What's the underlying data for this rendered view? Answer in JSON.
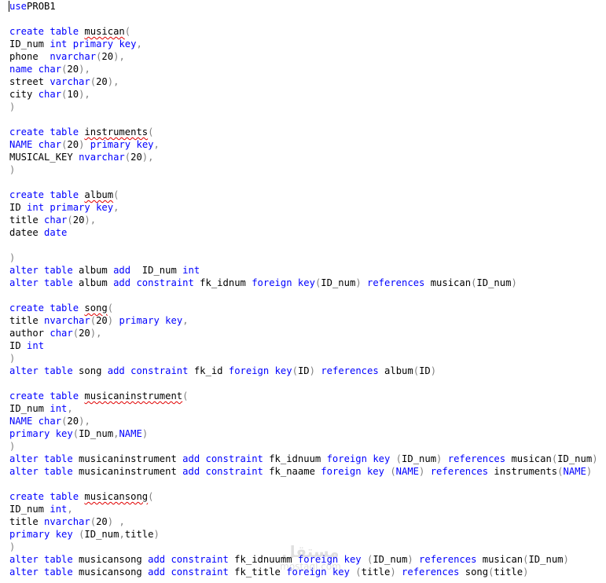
{
  "editor": {
    "lines": [
      [
        [
          "kw",
          "use"
        ],
        [
          "",
          "PROB1"
        ]
      ],
      [],
      [
        [
          "kw",
          "create"
        ],
        [
          "",
          " "
        ],
        [
          "kw",
          "table"
        ],
        [
          "",
          " "
        ],
        [
          "sq",
          "musican"
        ],
        [
          "gr",
          "("
        ]
      ],
      [
        [
          "",
          "ID_num "
        ],
        [
          "kw",
          "int"
        ],
        [
          "",
          " "
        ],
        [
          "kw",
          "primary"
        ],
        [
          "",
          " "
        ],
        [
          "kw",
          "key"
        ],
        [
          "gr",
          ","
        ]
      ],
      [
        [
          "",
          "phone  "
        ],
        [
          "kw",
          "nvarchar"
        ],
        [
          "gr",
          "("
        ],
        [
          "",
          "20"
        ],
        [
          "gr",
          ")"
        ],
        [
          "gr",
          ","
        ]
      ],
      [
        [
          "kw",
          "name"
        ],
        [
          "",
          " "
        ],
        [
          "kw",
          "char"
        ],
        [
          "gr",
          "("
        ],
        [
          "",
          "20"
        ],
        [
          "gr",
          ")"
        ],
        [
          "gr",
          ","
        ]
      ],
      [
        [
          "",
          "street "
        ],
        [
          "kw",
          "varchar"
        ],
        [
          "gr",
          "("
        ],
        [
          "",
          "20"
        ],
        [
          "gr",
          ")"
        ],
        [
          "gr",
          ","
        ]
      ],
      [
        [
          "",
          "city "
        ],
        [
          "kw",
          "char"
        ],
        [
          "gr",
          "("
        ],
        [
          "",
          "10"
        ],
        [
          "gr",
          ")"
        ],
        [
          "gr",
          ","
        ]
      ],
      [
        [
          "gr",
          ")"
        ]
      ],
      [],
      [
        [
          "kw",
          "create"
        ],
        [
          "",
          " "
        ],
        [
          "kw",
          "table"
        ],
        [
          "",
          " "
        ],
        [
          "sq",
          "instruments"
        ],
        [
          "gr",
          "("
        ]
      ],
      [
        [
          "kw",
          "NAME"
        ],
        [
          "",
          " "
        ],
        [
          "kw",
          "char"
        ],
        [
          "gr",
          "("
        ],
        [
          "",
          "20"
        ],
        [
          "gr",
          ")"
        ],
        [
          "",
          " "
        ],
        [
          "kw",
          "primary"
        ],
        [
          "",
          " "
        ],
        [
          "kw",
          "key"
        ],
        [
          "gr",
          ","
        ]
      ],
      [
        [
          "",
          "MUSICAL_KEY "
        ],
        [
          "kw",
          "nvarchar"
        ],
        [
          "gr",
          "("
        ],
        [
          "",
          "20"
        ],
        [
          "gr",
          ")"
        ],
        [
          "gr",
          ","
        ]
      ],
      [
        [
          "gr",
          ")"
        ]
      ],
      [],
      [
        [
          "kw",
          "create"
        ],
        [
          "",
          " "
        ],
        [
          "kw",
          "table"
        ],
        [
          "",
          " "
        ],
        [
          "sq",
          "album"
        ],
        [
          "gr",
          "("
        ]
      ],
      [
        [
          "",
          "ID "
        ],
        [
          "kw",
          "int"
        ],
        [
          "",
          " "
        ],
        [
          "kw",
          "primary"
        ],
        [
          "",
          " "
        ],
        [
          "kw",
          "key"
        ],
        [
          "gr",
          ","
        ]
      ],
      [
        [
          "",
          "title "
        ],
        [
          "kw",
          "char"
        ],
        [
          "gr",
          "("
        ],
        [
          "",
          "20"
        ],
        [
          "gr",
          ")"
        ],
        [
          "gr",
          ","
        ]
      ],
      [
        [
          "",
          "datee "
        ],
        [
          "kw",
          "date"
        ]
      ],
      [],
      [
        [
          "gr",
          ")"
        ]
      ],
      [
        [
          "kw",
          "alter"
        ],
        [
          "",
          " "
        ],
        [
          "kw",
          "table"
        ],
        [
          "",
          " album "
        ],
        [
          "kw",
          "add"
        ],
        [
          "",
          "  ID_num "
        ],
        [
          "kw",
          "int"
        ]
      ],
      [
        [
          "kw",
          "alter"
        ],
        [
          "",
          " "
        ],
        [
          "kw",
          "table"
        ],
        [
          "",
          " album "
        ],
        [
          "kw",
          "add"
        ],
        [
          "",
          " "
        ],
        [
          "kw",
          "constraint"
        ],
        [
          "",
          " fk_idnum "
        ],
        [
          "kw",
          "foreign"
        ],
        [
          "",
          " "
        ],
        [
          "kw",
          "key"
        ],
        [
          "gr",
          "("
        ],
        [
          "",
          "ID_num"
        ],
        [
          "gr",
          ")"
        ],
        [
          "",
          " "
        ],
        [
          "kw",
          "references"
        ],
        [
          "",
          " musican"
        ],
        [
          "gr",
          "("
        ],
        [
          "",
          "ID_num"
        ],
        [
          "gr",
          ")"
        ]
      ],
      [],
      [
        [
          "kw",
          "create"
        ],
        [
          "",
          " "
        ],
        [
          "kw",
          "table"
        ],
        [
          "",
          " "
        ],
        [
          "sq",
          "song"
        ],
        [
          "gr",
          "("
        ]
      ],
      [
        [
          "",
          "title "
        ],
        [
          "kw",
          "nvarchar"
        ],
        [
          "gr",
          "("
        ],
        [
          "",
          "20"
        ],
        [
          "gr",
          ")"
        ],
        [
          "",
          " "
        ],
        [
          "kw",
          "primary"
        ],
        [
          "",
          " "
        ],
        [
          "kw",
          "key"
        ],
        [
          "gr",
          ","
        ]
      ],
      [
        [
          "",
          "author "
        ],
        [
          "kw",
          "char"
        ],
        [
          "gr",
          "("
        ],
        [
          "",
          "20"
        ],
        [
          "gr",
          ")"
        ],
        [
          "gr",
          ","
        ]
      ],
      [
        [
          "",
          "ID "
        ],
        [
          "kw",
          "int"
        ]
      ],
      [
        [
          "gr",
          ")"
        ]
      ],
      [
        [
          "kw",
          "alter"
        ],
        [
          "",
          " "
        ],
        [
          "kw",
          "table"
        ],
        [
          "",
          " song "
        ],
        [
          "kw",
          "add"
        ],
        [
          "",
          " "
        ],
        [
          "kw",
          "constraint"
        ],
        [
          "",
          " fk_id "
        ],
        [
          "kw",
          "foreign"
        ],
        [
          "",
          " "
        ],
        [
          "kw",
          "key"
        ],
        [
          "gr",
          "("
        ],
        [
          "",
          "ID"
        ],
        [
          "gr",
          ")"
        ],
        [
          "",
          " "
        ],
        [
          "kw",
          "references"
        ],
        [
          "",
          " album"
        ],
        [
          "gr",
          "("
        ],
        [
          "",
          "ID"
        ],
        [
          "gr",
          ")"
        ]
      ],
      [],
      [
        [
          "kw",
          "create"
        ],
        [
          "",
          " "
        ],
        [
          "kw",
          "table"
        ],
        [
          "",
          " "
        ],
        [
          "sq",
          "musicaninstrument"
        ],
        [
          "gr",
          "("
        ]
      ],
      [
        [
          "",
          "ID_num "
        ],
        [
          "kw",
          "int"
        ],
        [
          "gr",
          ","
        ]
      ],
      [
        [
          "kw",
          "NAME"
        ],
        [
          "",
          " "
        ],
        [
          "kw",
          "char"
        ],
        [
          "gr",
          "("
        ],
        [
          "",
          "20"
        ],
        [
          "gr",
          ")"
        ],
        [
          "gr",
          ","
        ]
      ],
      [
        [
          "kw",
          "primary"
        ],
        [
          "",
          " "
        ],
        [
          "kw",
          "key"
        ],
        [
          "gr",
          "("
        ],
        [
          "",
          "ID_num"
        ],
        [
          "gr",
          ","
        ],
        [
          "kw",
          "NAME"
        ],
        [
          "gr",
          ")"
        ]
      ],
      [
        [
          "gr",
          ")"
        ]
      ],
      [
        [
          "kw",
          "alter"
        ],
        [
          "",
          " "
        ],
        [
          "kw",
          "table"
        ],
        [
          "",
          " musicaninstrument "
        ],
        [
          "kw",
          "add"
        ],
        [
          "",
          " "
        ],
        [
          "kw",
          "constraint"
        ],
        [
          "",
          " fk_idnuum "
        ],
        [
          "kw",
          "foreign"
        ],
        [
          "",
          " "
        ],
        [
          "kw",
          "key"
        ],
        [
          "",
          " "
        ],
        [
          "gr",
          "("
        ],
        [
          "",
          "ID_num"
        ],
        [
          "gr",
          ")"
        ],
        [
          "",
          " "
        ],
        [
          "kw",
          "references"
        ],
        [
          "",
          " musican"
        ],
        [
          "gr",
          "("
        ],
        [
          "",
          "ID_num"
        ],
        [
          "gr",
          ")"
        ]
      ],
      [
        [
          "kw",
          "alter"
        ],
        [
          "",
          " "
        ],
        [
          "kw",
          "table"
        ],
        [
          "",
          " musicaninstrument "
        ],
        [
          "kw",
          "add"
        ],
        [
          "",
          " "
        ],
        [
          "kw",
          "constraint"
        ],
        [
          "",
          " fk_naame "
        ],
        [
          "kw",
          "foreign"
        ],
        [
          "",
          " "
        ],
        [
          "kw",
          "key"
        ],
        [
          "",
          " "
        ],
        [
          "gr",
          "("
        ],
        [
          "kw",
          "NAME"
        ],
        [
          "gr",
          ")"
        ],
        [
          "",
          " "
        ],
        [
          "kw",
          "references"
        ],
        [
          "",
          " instruments"
        ],
        [
          "gr",
          "("
        ],
        [
          "kw",
          "NAME"
        ],
        [
          "gr",
          ")"
        ]
      ],
      [],
      [
        [
          "kw",
          "create"
        ],
        [
          "",
          " "
        ],
        [
          "kw",
          "table"
        ],
        [
          "",
          " "
        ],
        [
          "sq",
          "musicansong"
        ],
        [
          "gr",
          "("
        ]
      ],
      [
        [
          "",
          "ID_num "
        ],
        [
          "kw",
          "int"
        ],
        [
          "gr",
          ","
        ]
      ],
      [
        [
          "",
          "title "
        ],
        [
          "kw",
          "nvarchar"
        ],
        [
          "gr",
          "("
        ],
        [
          "",
          "20"
        ],
        [
          "gr",
          ")"
        ],
        [
          "",
          " "
        ],
        [
          "gr",
          ","
        ]
      ],
      [
        [
          "kw",
          "primary"
        ],
        [
          "",
          " "
        ],
        [
          "kw",
          "key"
        ],
        [
          "",
          " "
        ],
        [
          "gr",
          "("
        ],
        [
          "",
          "ID_num"
        ],
        [
          "gr",
          ","
        ],
        [
          "",
          "title"
        ],
        [
          "gr",
          ")"
        ]
      ],
      [
        [
          "gr",
          ")"
        ]
      ],
      [
        [
          "kw",
          "alter"
        ],
        [
          "",
          " "
        ],
        [
          "kw",
          "table"
        ],
        [
          "",
          " musicansong "
        ],
        [
          "kw",
          "add"
        ],
        [
          "",
          " "
        ],
        [
          "kw",
          "constraint"
        ],
        [
          "",
          " fk_idnuumm "
        ],
        [
          "kw",
          "foreign"
        ],
        [
          "",
          " "
        ],
        [
          "kw",
          "key"
        ],
        [
          "",
          " "
        ],
        [
          "gr",
          "("
        ],
        [
          "",
          "ID_num"
        ],
        [
          "gr",
          ")"
        ],
        [
          "",
          " "
        ],
        [
          "kw",
          "references"
        ],
        [
          "",
          " musican"
        ],
        [
          "gr",
          "("
        ],
        [
          "",
          "ID_num"
        ],
        [
          "gr",
          ")"
        ]
      ],
      [
        [
          "kw",
          "alter"
        ],
        [
          "",
          " "
        ],
        [
          "kw",
          "table"
        ],
        [
          "",
          " musicansong "
        ],
        [
          "kw",
          "add"
        ],
        [
          "",
          " "
        ],
        [
          "kw",
          "constraint"
        ],
        [
          "",
          " fk_title "
        ],
        [
          "kw",
          "foreign"
        ],
        [
          "",
          " "
        ],
        [
          "kw",
          "key"
        ],
        [
          "",
          " "
        ],
        [
          "gr",
          "("
        ],
        [
          "",
          "title"
        ],
        [
          "gr",
          ")"
        ],
        [
          "",
          " "
        ],
        [
          "kw",
          "references"
        ],
        [
          "",
          " song"
        ],
        [
          "gr",
          "("
        ],
        [
          "",
          "title"
        ],
        [
          "gr",
          ")"
        ]
      ]
    ]
  },
  "watermark": {
    "logo": "مستقل",
    "text": "mostaql.com"
  }
}
